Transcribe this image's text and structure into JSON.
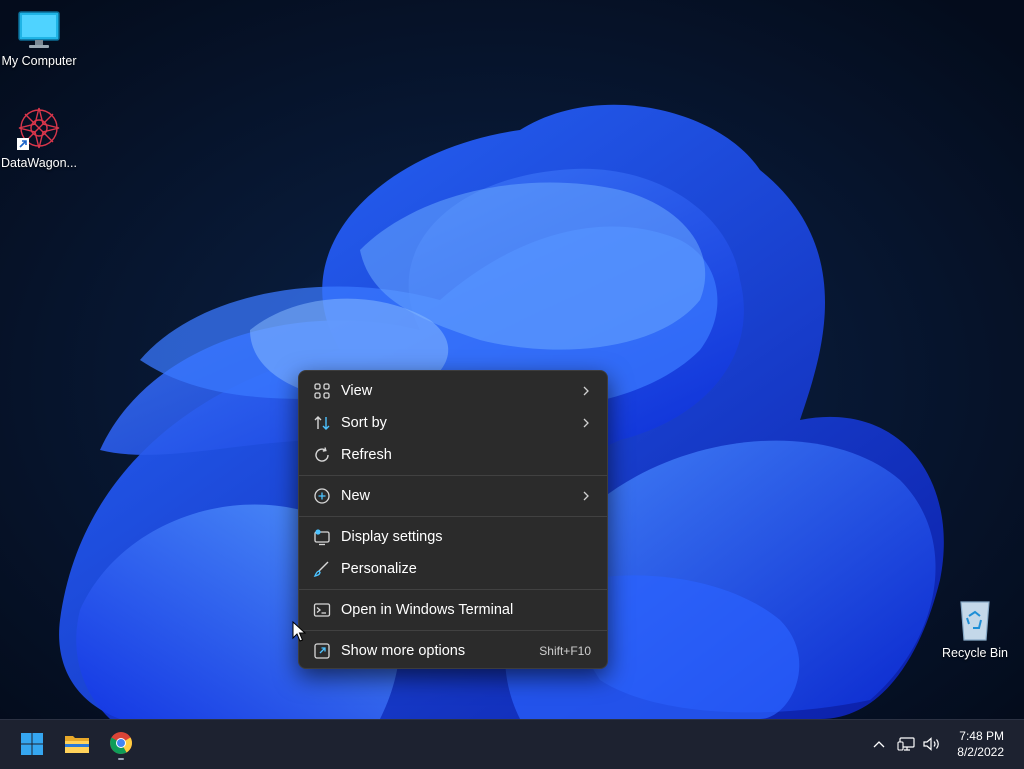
{
  "desktop": {
    "icons": [
      {
        "label": "My Computer",
        "icon": "monitor-icon"
      },
      {
        "label": "DataWagon...",
        "icon": "datawagon-logo-icon"
      },
      {
        "label": "Recycle Bin",
        "icon": "recycle-bin-icon"
      }
    ]
  },
  "context_menu": {
    "items": [
      {
        "label": "View",
        "icon": "view-grid-icon",
        "submenu": true
      },
      {
        "label": "Sort by",
        "icon": "sort-arrows-icon",
        "submenu": true
      },
      {
        "label": "Refresh",
        "icon": "refresh-icon",
        "submenu": false
      },
      {
        "label": "New",
        "icon": "plus-circle-icon",
        "submenu": true
      },
      {
        "label": "Display settings",
        "icon": "display-settings-icon",
        "submenu": false
      },
      {
        "label": "Personalize",
        "icon": "brush-icon",
        "submenu": false
      },
      {
        "label": "Open in Windows Terminal",
        "icon": "terminal-icon",
        "submenu": false
      },
      {
        "label": "Show more options",
        "icon": "more-options-icon",
        "submenu": false,
        "shortcut": "Shift+F10"
      }
    ]
  },
  "taskbar": {
    "pinned": [
      {
        "name": "Start",
        "icon": "windows-start-icon"
      },
      {
        "name": "File Explorer",
        "icon": "folder-icon"
      },
      {
        "name": "Google Chrome",
        "icon": "chrome-icon"
      }
    ],
    "tray_icons": [
      "chevron-up-icon",
      "network-icon",
      "volume-icon"
    ],
    "clock": {
      "time": "7:48 PM",
      "date": "8/2/2022"
    }
  },
  "colors": {
    "accent": "#0f5bff",
    "menu_bg": "#2b2b2b",
    "taskbar_bg": "#1d2230"
  }
}
